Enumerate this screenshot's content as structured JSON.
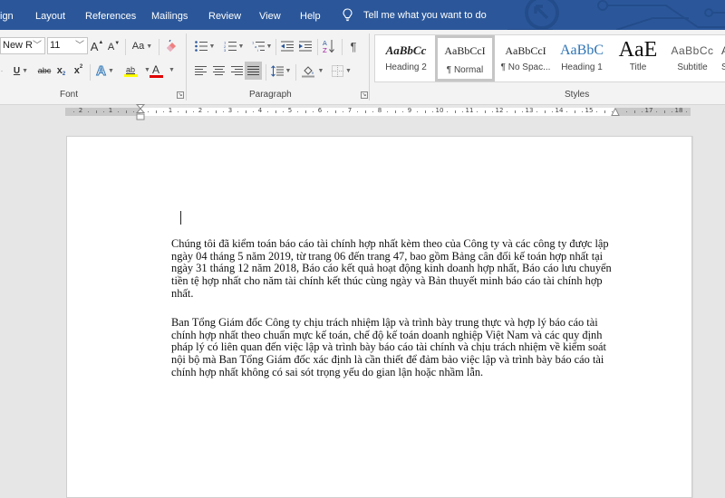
{
  "tabs": [
    {
      "label": "ign",
      "name": "tab-design"
    },
    {
      "label": "Layout",
      "name": "tab-layout"
    },
    {
      "label": "References",
      "name": "tab-references"
    },
    {
      "label": "Mailings",
      "name": "tab-mailings"
    },
    {
      "label": "Review",
      "name": "tab-review"
    },
    {
      "label": "View",
      "name": "tab-view"
    },
    {
      "label": "Help",
      "name": "tab-help"
    }
  ],
  "tell_me": {
    "placeholder": "Tell me what you want to do",
    "icon": "lightbulb-icon"
  },
  "ribbon": {
    "font": {
      "group_label": "Font",
      "font_name": "New R",
      "font_size": "11",
      "grow_font": "A",
      "shrink_font": "A",
      "change_case": "Aa",
      "underline": "U",
      "strikethrough": "abc",
      "subscript": "x",
      "superscript": "x",
      "text_effects": "A",
      "highlight": "ab",
      "font_color": "A",
      "highlight_color": "#ffff00",
      "font_color_value": "#e00000"
    },
    "paragraph": {
      "group_label": "Paragraph",
      "pilcrow": "¶",
      "active_alignment": "justify"
    },
    "styles": {
      "group_label": "Styles",
      "items": [
        {
          "preview": "AaBbCc",
          "name": "Heading 2",
          "selected": false
        },
        {
          "preview": "AaBbCcI",
          "name": "¶ Normal",
          "selected": true
        },
        {
          "preview": "AaBbCcI",
          "name": "¶ No Spac...",
          "selected": false
        },
        {
          "preview": "AaBbC",
          "name": "Heading 1",
          "selected": false
        },
        {
          "preview": "AaE",
          "name": "Title",
          "selected": false
        },
        {
          "preview": "AaBbCc",
          "name": "Subtitle",
          "selected": false
        },
        {
          "preview": "A",
          "name": "S",
          "selected": false
        }
      ]
    }
  },
  "ruler": {
    "left_labels": [
      "2",
      "1"
    ],
    "right_labels": [
      "1",
      "2",
      "3",
      "4",
      "5",
      "6",
      "7",
      "8",
      "9",
      "10",
      "11",
      "12",
      "13",
      "14",
      "15"
    ],
    "right_margin_labels": [
      "17",
      "18"
    ]
  },
  "document": {
    "paragraphs": [
      "Chúng tôi đã kiểm toán báo cáo tài chính hợp nhất kèm theo của Công ty và các công ty được lập ngày 04 tháng 5 năm 2019, từ trang 06 đến trang 47, bao gồm Bảng cân đối kế toán hợp nhất tại ngày 31 tháng 12 năm 2018, Báo cáo kết quả hoạt động kinh doanh hợp nhất, Báo cáo lưu chuyển tiền tệ hợp nhất cho năm tài chính kết thúc cùng ngày và Bản thuyết minh báo cáo tài chính hợp nhất.",
      "Ban Tổng Giám đốc Công ty chịu trách nhiệm lập và trình bày trung thực và hợp lý báo cáo tài chính hợp nhất theo chuẩn mực kế toán, chế độ kế toán doanh nghiệp Việt Nam và các quy định pháp lý có liên quan đến việc lập và trình bày báo cáo tài chính và chịu trách nhiệm về kiểm soát nội bộ mà Ban Tổng Giám đốc xác định là cần thiết để đảm bảo việc lập và trình bày báo cáo tài chính hợp nhất không có sai sót trọng yếu do gian lận hoặc nhầm lẫn."
    ]
  },
  "colors": {
    "tabbar": "#2b579a",
    "ribbon": "#f3f3f3",
    "canvas": "#e6e6e6",
    "heading_blue": "#2e74b5"
  }
}
